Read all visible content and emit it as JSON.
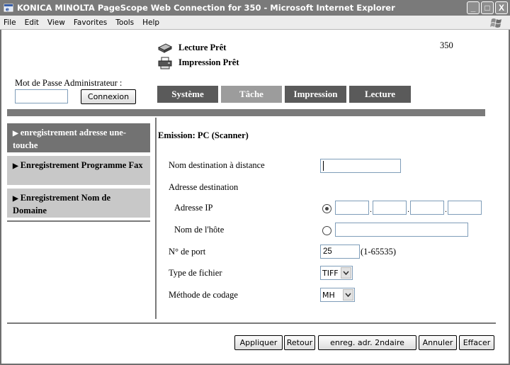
{
  "window": {
    "title": "KONICA MINOLTA PageScope Web Connection for 350 - Microsoft Internet Explorer",
    "menu": [
      "File",
      "Edit",
      "View",
      "Favorites",
      "Tools",
      "Help"
    ],
    "buttons": {
      "minimize": "_",
      "maximize": "□",
      "close": "X"
    }
  },
  "header": {
    "scanner_status": "Lecture Prêt",
    "printer_status": "Impression Prêt",
    "model": "350",
    "admin_label": "Mot de Passe Administrateur :",
    "admin_password_value": "",
    "login_button": "Connexion"
  },
  "tabs": [
    {
      "label": "Système",
      "selected": false
    },
    {
      "label": "Tâche",
      "selected": true
    },
    {
      "label": "Impression",
      "selected": false
    },
    {
      "label": "Lecture",
      "selected": false
    }
  ],
  "sidebar": {
    "items": [
      {
        "label": "enregistrement adresse une-touche",
        "active": true
      },
      {
        "label": "Enregistrement Programme Fax",
        "active": false
      },
      {
        "label": "Enregistrement Nom de Domaine",
        "active": false
      }
    ]
  },
  "form": {
    "title": "Emission: PC (Scanner)",
    "remote_name_label": "Nom destination à distance",
    "remote_name_value": "",
    "dest_address_label": "Adresse destination",
    "ip_label": "Adresse IP",
    "ip_selected": true,
    "ip_octets": [
      "",
      "",
      "",
      ""
    ],
    "ip_separator": ".",
    "hostname_label": "Nom de l'hôte",
    "hostname_value": "",
    "port_label": "N° de port",
    "port_value": "25",
    "port_range": "(1-65535)",
    "file_type_label": "Type de fichier",
    "file_type_value": "TIFF",
    "coding_label": "Méthode de codage",
    "coding_value": "MH"
  },
  "actions": {
    "apply": "Appliquer",
    "back": "Retour",
    "secondary": "enreg. adr. 2ndaire",
    "cancel": "Annuler",
    "clear": "Effacer"
  }
}
